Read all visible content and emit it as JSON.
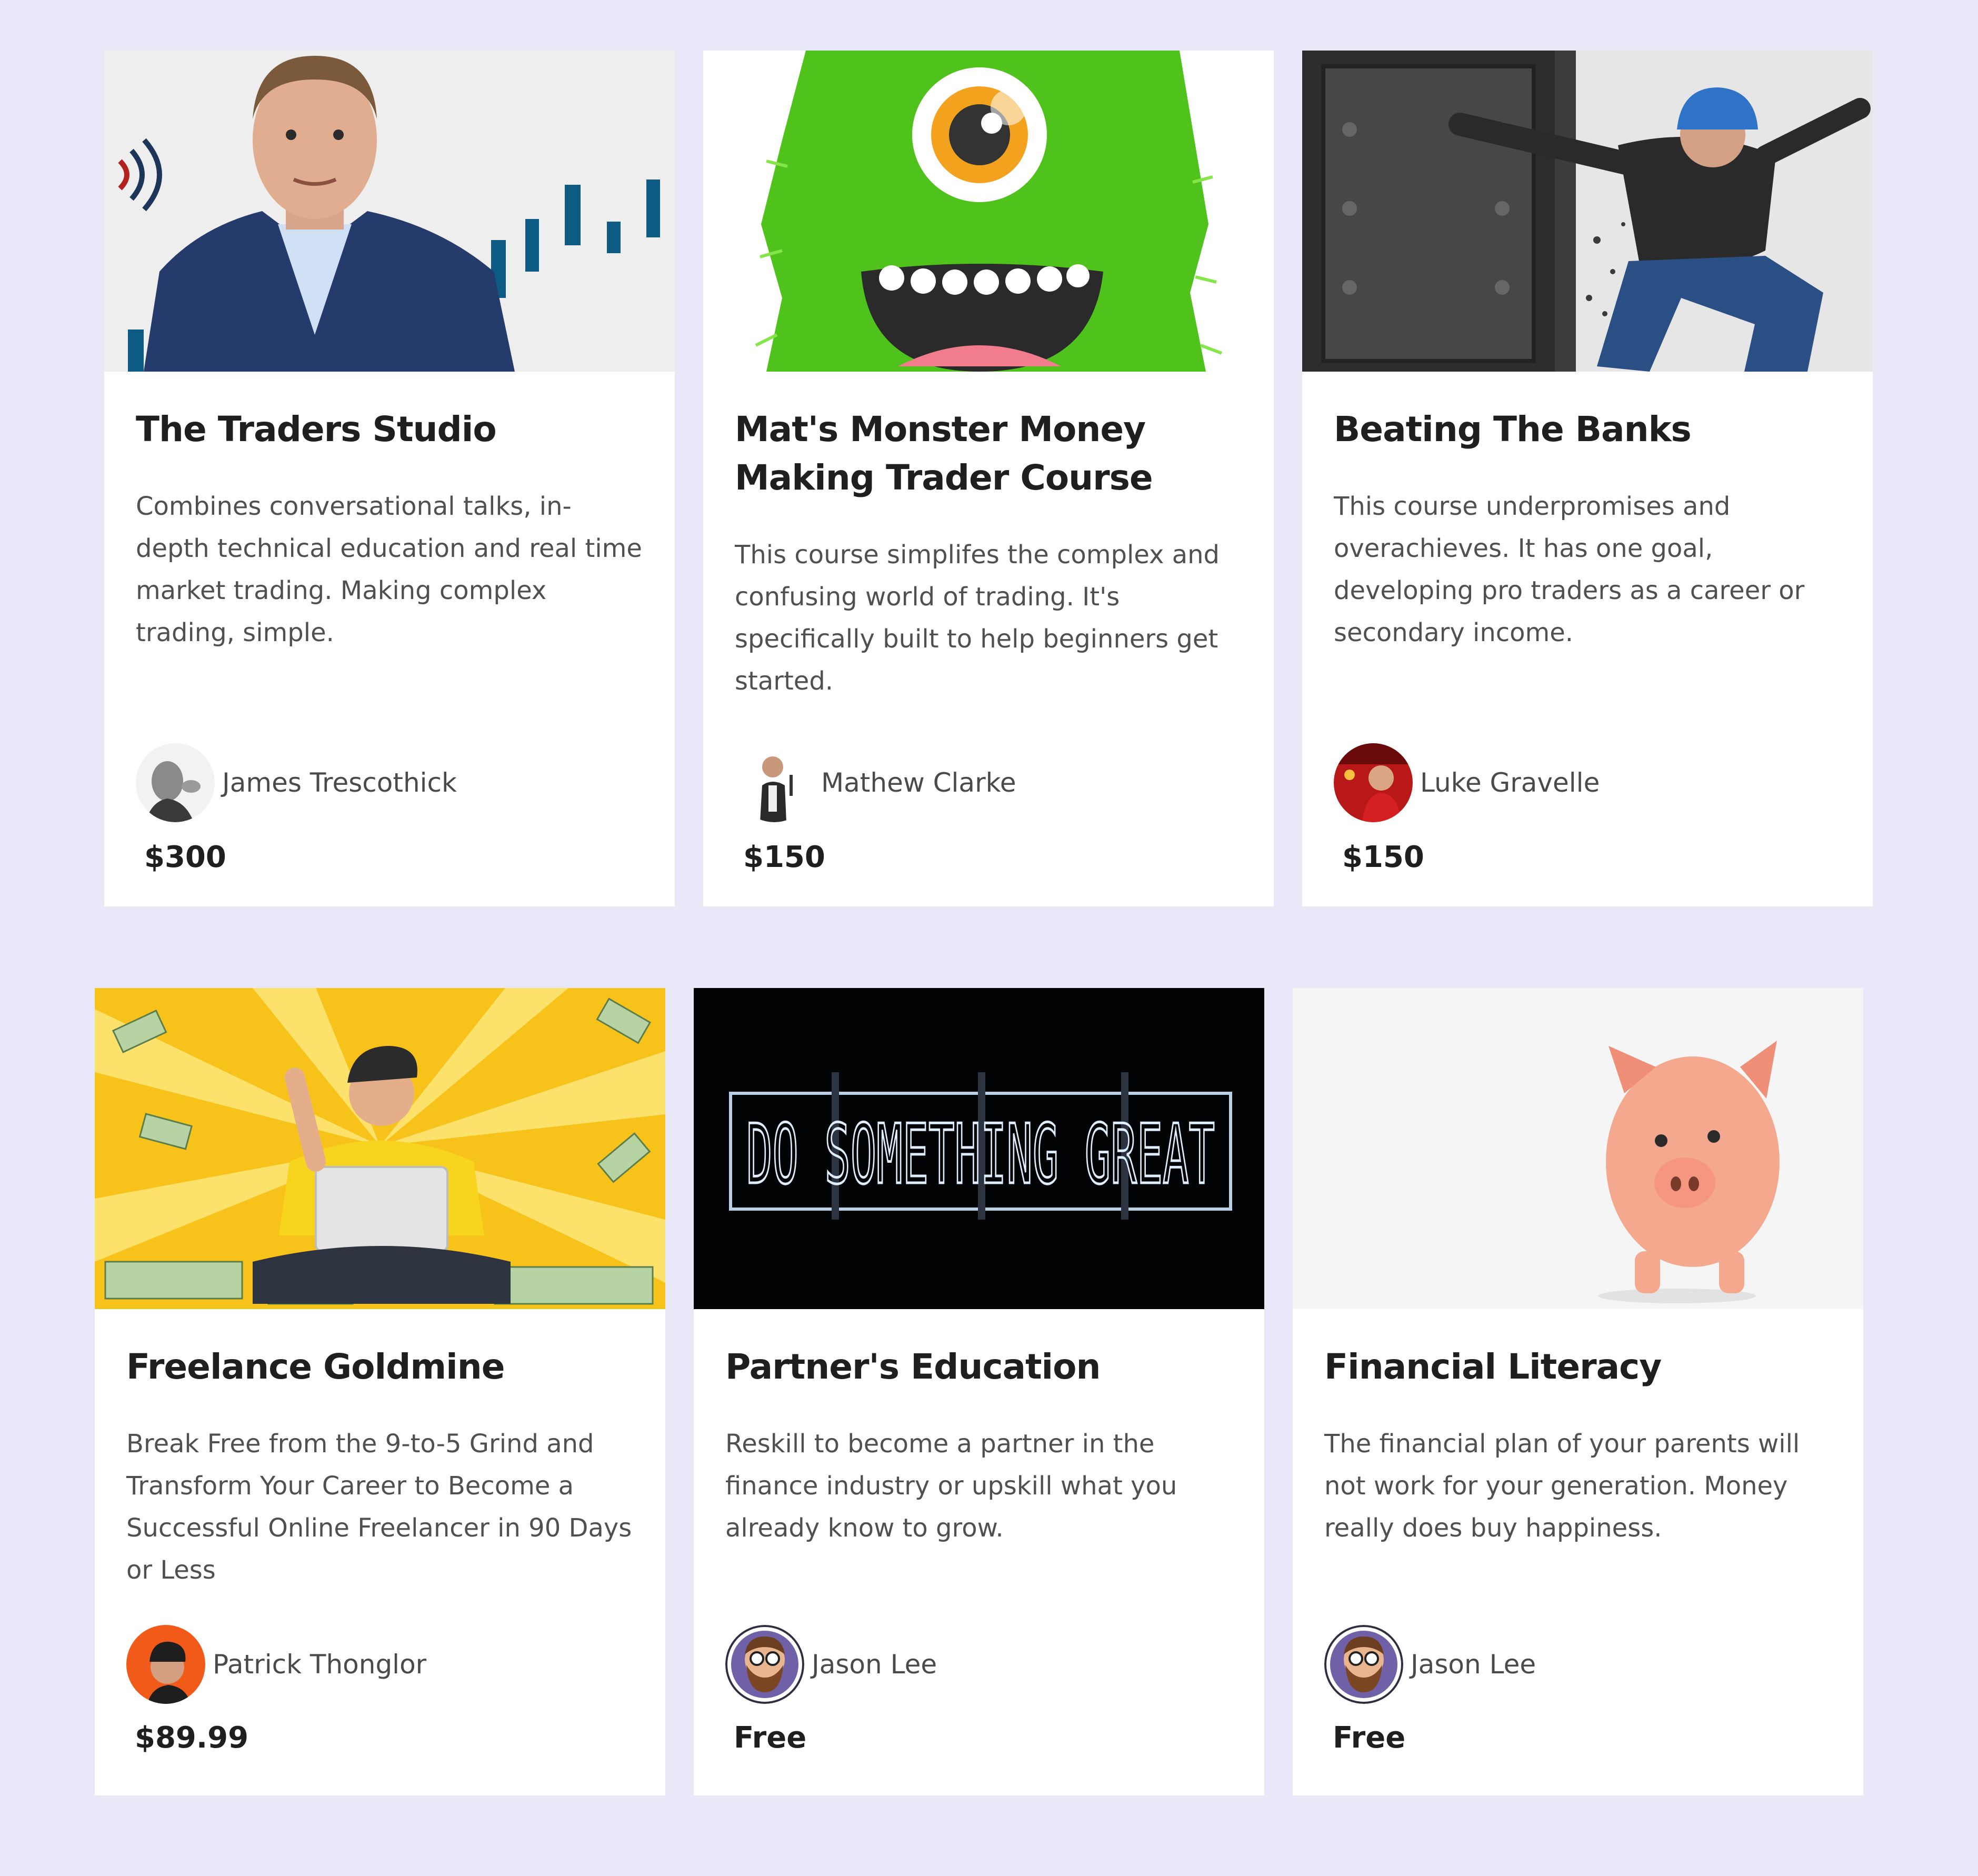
{
  "courses": [
    {
      "title": "The Traders Studio",
      "description": "Combines conversational talks, in-depth technical education and real time market trading. Making complex trading, simple.",
      "author": "James Trescothick",
      "price": "$300",
      "image": "man-in-suit-with-chart-bars"
    },
    {
      "title": "Mat's Monster Money Making Trader Course",
      "description": "This course simplifes the complex and confusing world of trading. It's specifically built to help beginners get started.",
      "author": "Mathew Clarke",
      "price": "$150",
      "image": "green-furry-monster"
    },
    {
      "title": "Beating The Banks",
      "description": "This course underpromises and overachieves. It has one goal, developing pro traders as a career or secondary income.",
      "author": "Luke Gravelle",
      "price": "$150",
      "image": "man-breaking-vault-door"
    },
    {
      "title": "Freelance Goldmine",
      "description": "Break Free from the 9-to-5 Grind and Transform Your Career to Become a Successful Online Freelancer in 90 Days or Less",
      "author": "Patrick Thonglor",
      "price": "$89.99",
      "image": "man-with-laptop-and-money"
    },
    {
      "title": "Partner's Education",
      "description": "Reskill to become a partner in the finance industry or upskill what you already know to grow.",
      "author": "Jason Lee",
      "price": "Free",
      "image": "neon-sign",
      "image_text": "DO SOMETHING GREAT"
    },
    {
      "title": "Financial Literacy",
      "description": "The financial plan of your parents will not work for your generation. Money really does buy happiness.",
      "author": "Jason Lee",
      "price": "Free",
      "image": "piggy-bank"
    }
  ],
  "colors": {
    "page_background": "#e8e8f8",
    "card_background": "#ffffff",
    "title_text": "#1f1f1f",
    "body_text": "#505050"
  }
}
